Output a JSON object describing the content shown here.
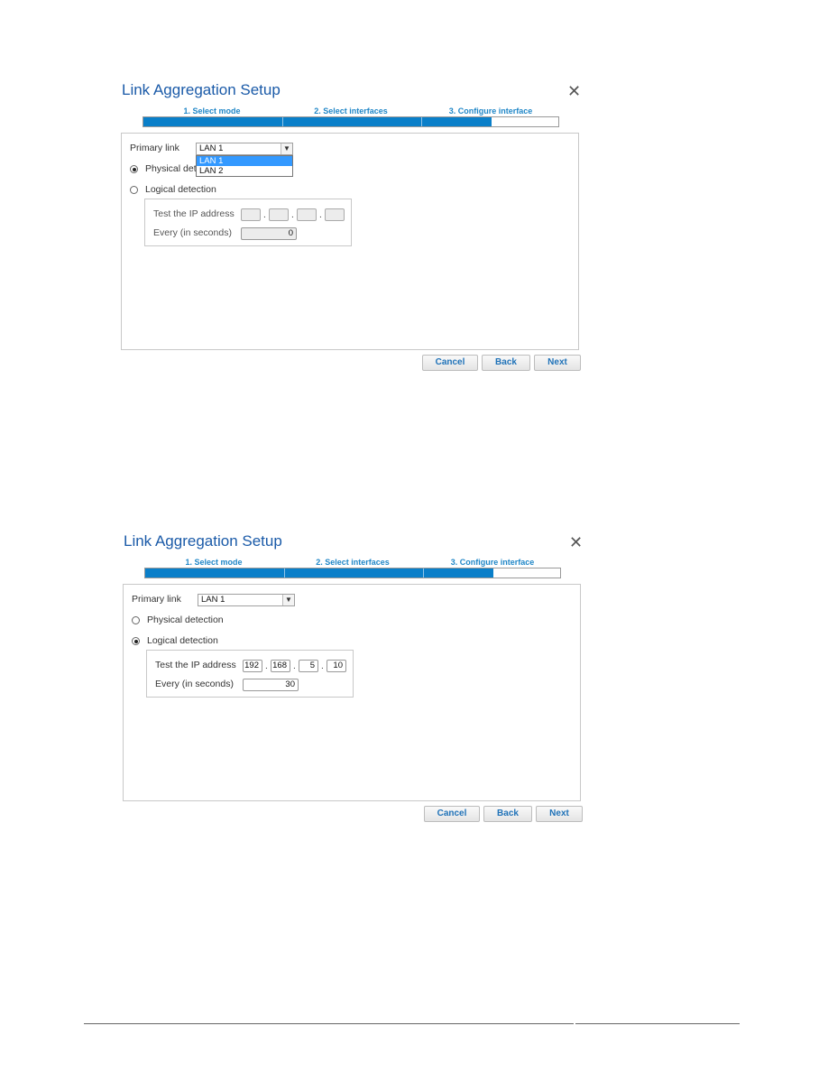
{
  "screens": [
    {
      "title": "Link Aggregation Setup",
      "steps": [
        "1. Select mode",
        "2. Select interfaces",
        "3. Configure interface"
      ],
      "progress_percent": 83,
      "primary_link": {
        "label": "Primary link",
        "value": "LAN 1",
        "dropdown_open": true,
        "options": [
          "LAN 1",
          "LAN 2"
        ],
        "highlighted_option": "LAN 1"
      },
      "physical_detection": {
        "label": "Physical detection",
        "selected": true
      },
      "logical_detection": {
        "label": "Logical detection",
        "selected": false
      },
      "test_ip": {
        "label": "Test the IP address",
        "octets": [
          "",
          "",
          "",
          ""
        ],
        "enabled": false
      },
      "interval": {
        "label": "Every (in seconds)",
        "value": "0",
        "enabled": false
      },
      "buttons": {
        "cancel": "Cancel",
        "back": "Back",
        "next": "Next"
      }
    },
    {
      "title": "Link Aggregation Setup",
      "steps": [
        "1. Select mode",
        "2. Select interfaces",
        "3. Configure interface"
      ],
      "progress_percent": 83,
      "primary_link": {
        "label": "Primary link",
        "value": "LAN 1",
        "dropdown_open": false
      },
      "physical_detection": {
        "label": "Physical detection",
        "selected": false
      },
      "logical_detection": {
        "label": "Logical detection",
        "selected": true
      },
      "test_ip": {
        "label": "Test the IP address",
        "octets": [
          "192",
          "168",
          "5",
          "10"
        ],
        "enabled": true
      },
      "interval": {
        "label": "Every (in seconds)",
        "value": "30",
        "enabled": true
      },
      "buttons": {
        "cancel": "Cancel",
        "back": "Back",
        "next": "Next"
      }
    }
  ],
  "icons": {
    "close": "close-icon",
    "dropdown_arrow": "chevron-down-icon"
  },
  "colors": {
    "accent": "#0a7fc9",
    "title": "#1a5aa8",
    "step_label": "#1f86c7",
    "highlight": "#3399ff"
  }
}
